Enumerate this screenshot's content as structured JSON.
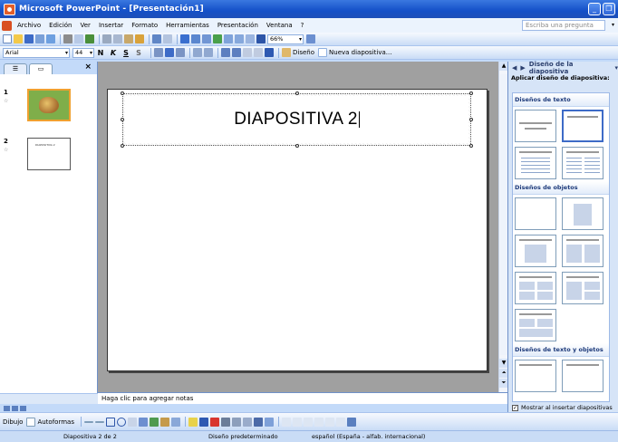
{
  "window": {
    "title": "Microsoft PowerPoint - [Presentación1]"
  },
  "menu": {
    "items": [
      "Archivo",
      "Edición",
      "Ver",
      "Insertar",
      "Formato",
      "Herramientas",
      "Presentación",
      "Ventana",
      "?"
    ],
    "help_placeholder": "Escriba una pregunta"
  },
  "toolbar": {
    "zoom": "66%",
    "font": "Arial",
    "font_size": "44",
    "design_label": "Diseño",
    "new_slide_label": "Nueva diapositiva...",
    "bold": "N",
    "italic": "K",
    "underline": "S",
    "shadow": "S"
  },
  "slide_panel": {
    "close_glyph": "×",
    "slides": [
      {
        "number": "1",
        "star": "☆"
      },
      {
        "number": "2",
        "star": "☆",
        "thumb_text": "DIAPOSITIVA 2"
      }
    ]
  },
  "slide": {
    "title": "DIAPOSITIVA 2"
  },
  "notes": {
    "placeholder": "Haga clic para agregar notas"
  },
  "task_pane": {
    "title": "Diseño de la diapositiva",
    "subtitle": "Aplicar diseño de diapositiva:",
    "sections": [
      "Diseños de texto",
      "Diseños de objetos",
      "Diseños de texto y objetos"
    ],
    "show_on_insert": "Mostrar al insertar diapositivas",
    "show_checked": true
  },
  "drawing": {
    "draw_label": "Dibujo",
    "autoshapes_label": "Autoformas"
  },
  "status": {
    "slide_pos": "Diapositiva 2 de 2",
    "design": "Diseño predeterminado",
    "language": "español (España - alfab. internacional)"
  },
  "colors": {
    "titlebar": "#1450c8",
    "toolbar_bg": "#c3daf9",
    "accent_orange": "#f0a030"
  }
}
